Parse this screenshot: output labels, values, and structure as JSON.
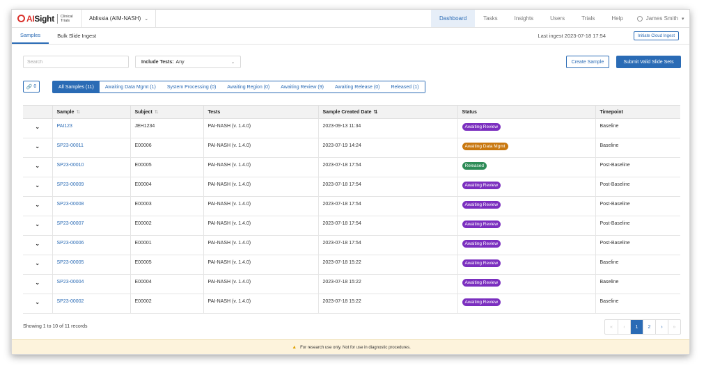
{
  "app": {
    "logo_brand_prefix": "AI",
    "logo_brand_suffix": "Sight",
    "logo_sub_line1": "Clinical",
    "logo_sub_line2": "Trials",
    "project": "Ablissia (AIM-NASH)"
  },
  "topnav": {
    "items": [
      {
        "label": "Dashboard",
        "active": true
      },
      {
        "label": "Tasks"
      },
      {
        "label": "Insights"
      },
      {
        "label": "Users"
      },
      {
        "label": "Trials"
      },
      {
        "label": "Help"
      }
    ],
    "user_name": "James Smith"
  },
  "subnav": {
    "tabs": [
      {
        "label": "Samples",
        "active": true
      },
      {
        "label": "Bulk Slide Ingest"
      }
    ],
    "last_ingest": "Last ingest 2023-07-18 17:54",
    "cloud_button": "Initiate Cloud Ingest"
  },
  "filters": {
    "search_placeholder": "Search",
    "tests_label": "Include Tests:",
    "tests_value": "Any",
    "create_button": "Create Sample",
    "submit_button": "Submit Valid Slide Sets",
    "link_count": "0"
  },
  "status_tabs": [
    {
      "label": "All Samples (11)",
      "active": true
    },
    {
      "label": "Awaiting Data Mgmt (1)"
    },
    {
      "label": "System Processing (0)"
    },
    {
      "label": "Awaiting Region (0)"
    },
    {
      "label": "Awaiting Review (9)"
    },
    {
      "label": "Awaiting Release (0)"
    },
    {
      "label": "Released (1)"
    }
  ],
  "table": {
    "columns": [
      "Sample",
      "Subject",
      "Tests",
      "Sample Created Date",
      "Status",
      "Timepoint"
    ],
    "rows": [
      {
        "sample": "PAI123",
        "subject": "JEH1234",
        "tests": "PAI-NASH (v. 1.4.0)",
        "date": "2023-09-13 11:34",
        "status": "Awaiting Review",
        "timepoint": "Baseline"
      },
      {
        "sample": "SP23-00011",
        "subject": "E00006",
        "tests": "PAI-NASH (v. 1.4.0)",
        "date": "2023-07-19 14:24",
        "status": "Awaiting Data Mgmt",
        "timepoint": "Baseline"
      },
      {
        "sample": "SP23-00010",
        "subject": "E00005",
        "tests": "PAI-NASH (v. 1.4.0)",
        "date": "2023-07-18 17:54",
        "status": "Released",
        "timepoint": "Post-Baseline"
      },
      {
        "sample": "SP23-00009",
        "subject": "E00004",
        "tests": "PAI-NASH (v. 1.4.0)",
        "date": "2023-07-18 17:54",
        "status": "Awaiting Review",
        "timepoint": "Post-Baseline"
      },
      {
        "sample": "SP23-00008",
        "subject": "E00003",
        "tests": "PAI-NASH (v. 1.4.0)",
        "date": "2023-07-18 17:54",
        "status": "Awaiting Review",
        "timepoint": "Post-Baseline"
      },
      {
        "sample": "SP23-00007",
        "subject": "E00002",
        "tests": "PAI-NASH (v. 1.4.0)",
        "date": "2023-07-18 17:54",
        "status": "Awaiting Review",
        "timepoint": "Post-Baseline"
      },
      {
        "sample": "SP23-00006",
        "subject": "E00001",
        "tests": "PAI-NASH (v. 1.4.0)",
        "date": "2023-07-18 17:54",
        "status": "Awaiting Review",
        "timepoint": "Post-Baseline"
      },
      {
        "sample": "SP23-00005",
        "subject": "E00005",
        "tests": "PAI-NASH (v. 1.4.0)",
        "date": "2023-07-18 15:22",
        "status": "Awaiting Review",
        "timepoint": "Baseline"
      },
      {
        "sample": "SP23-00004",
        "subject": "E00004",
        "tests": "PAI-NASH (v. 1.4.0)",
        "date": "2023-07-18 15:22",
        "status": "Awaiting Review",
        "timepoint": "Baseline"
      },
      {
        "sample": "SP23-00002",
        "subject": "E00002",
        "tests": "PAI-NASH (v. 1.4.0)",
        "date": "2023-07-18 15:22",
        "status": "Awaiting Review",
        "timepoint": "Baseline"
      }
    ]
  },
  "status_colors": {
    "Awaiting Review": "#7b2fbf",
    "Awaiting Data Mgmt": "#c9780f",
    "Released": "#2e8b57"
  },
  "footer": {
    "showing": "Showing 1 to 10 of 11 records",
    "pages": [
      "1",
      "2"
    ],
    "current_page": "1",
    "disclaimer": "For research use only. Not for use in diagnostic procedures."
  },
  "colors": {
    "primary": "#2a6bb5",
    "logo_red": "#d9312b",
    "disclaimer_bg": "#fdf3dc"
  }
}
